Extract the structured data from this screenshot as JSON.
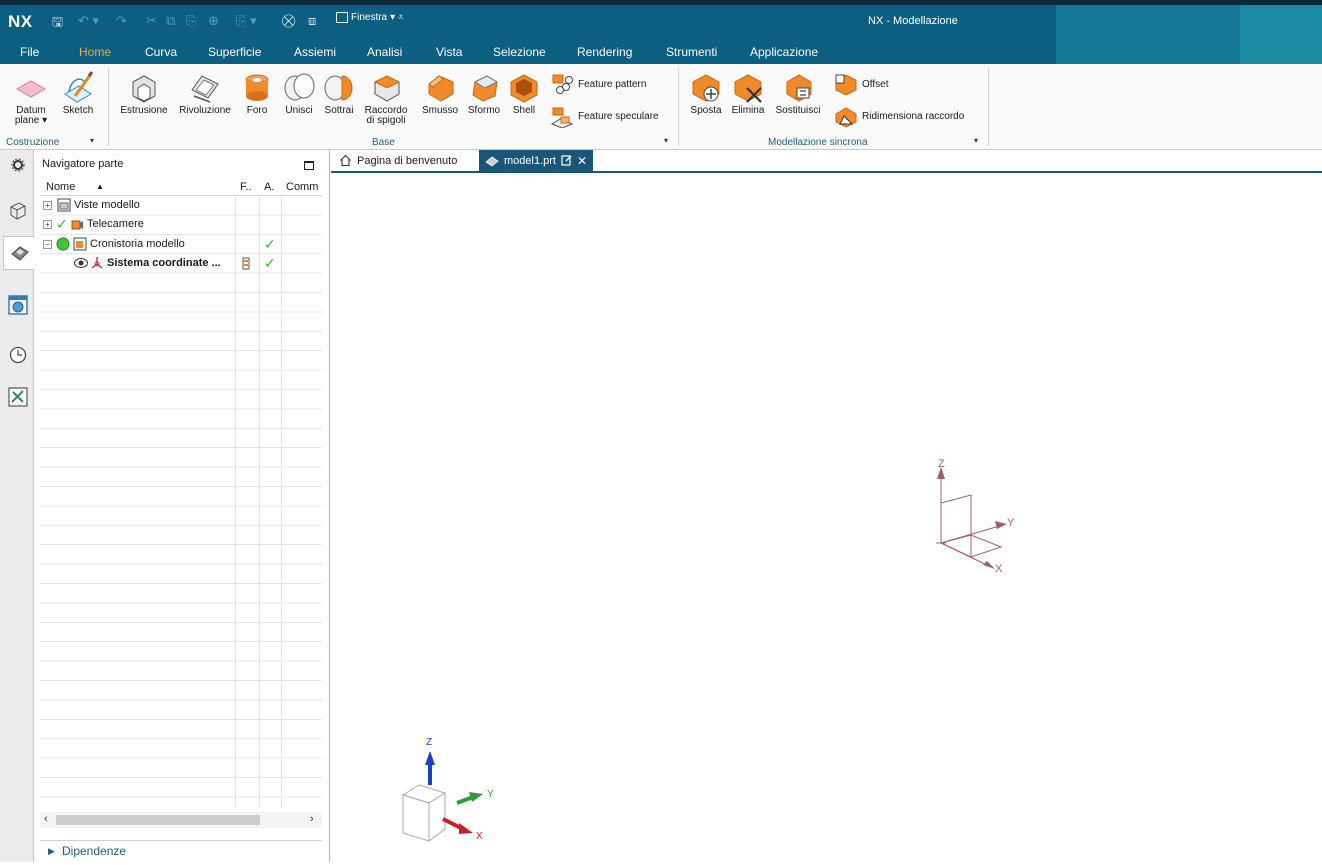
{
  "app": {
    "logo": "NX",
    "window_menu": "Finestra",
    "title": "NX - Modellazione"
  },
  "menu_tabs": [
    "File",
    "Home",
    "Curva",
    "Superficie",
    "Assiemi",
    "Analisi",
    "Vista",
    "Selezione",
    "Rendering",
    "Strumenti",
    "Applicazione"
  ],
  "ribbon": {
    "costruzione": {
      "label": "Costruzione",
      "datum_plane": "Datum\nplane ▾",
      "sketch": "Sketch"
    },
    "base": {
      "label": "Base",
      "estrusione": "Estrusione",
      "rivoluzione": "Rivoluzione",
      "foro": "Foro",
      "unisci": "Unisci",
      "sottrai": "Sottrai",
      "raccordo": "Raccordo\ndi spigoli",
      "smusso": "Smusso",
      "sformo": "Sformo",
      "shell": "Shell",
      "feature_pattern": "Feature pattern",
      "feature_speculare": "Feature speculare"
    },
    "sincrona": {
      "label": "Modellazione sincrona",
      "sposta": "Sposta",
      "elimina": "Elimina",
      "sostituisci": "Sostituisci",
      "offset": "Offset",
      "ridimensiona": "Ridimensiona raccordo"
    }
  },
  "navigator": {
    "title": "Navigatore parte",
    "columns": {
      "name": "Nome",
      "f": "F..",
      "a": "A.",
      "comm": "Comm"
    },
    "rows": [
      {
        "name": "Viste modello",
        "expander": "+"
      },
      {
        "name": "Telecamere",
        "expander": "+"
      },
      {
        "name": "Cronistoria modello",
        "expander": "−"
      },
      {
        "name": "Sistema coordinate ..."
      }
    ],
    "footer": "Dipendenze"
  },
  "doc_tabs": [
    "Pagina di benvenuto",
    "model1.prt"
  ],
  "triad_labels": {
    "z": "Z",
    "y": "Y",
    "x": "X"
  },
  "colors": {
    "titlebar": "#0c5f80",
    "active_tab_text": "#f0a83a",
    "doc_tab_active": "#1a5678",
    "triad_x": "#c8202a",
    "triad_y": "#2f9a3a",
    "triad_z": "#1e3fc4",
    "csys": "#a06068"
  }
}
